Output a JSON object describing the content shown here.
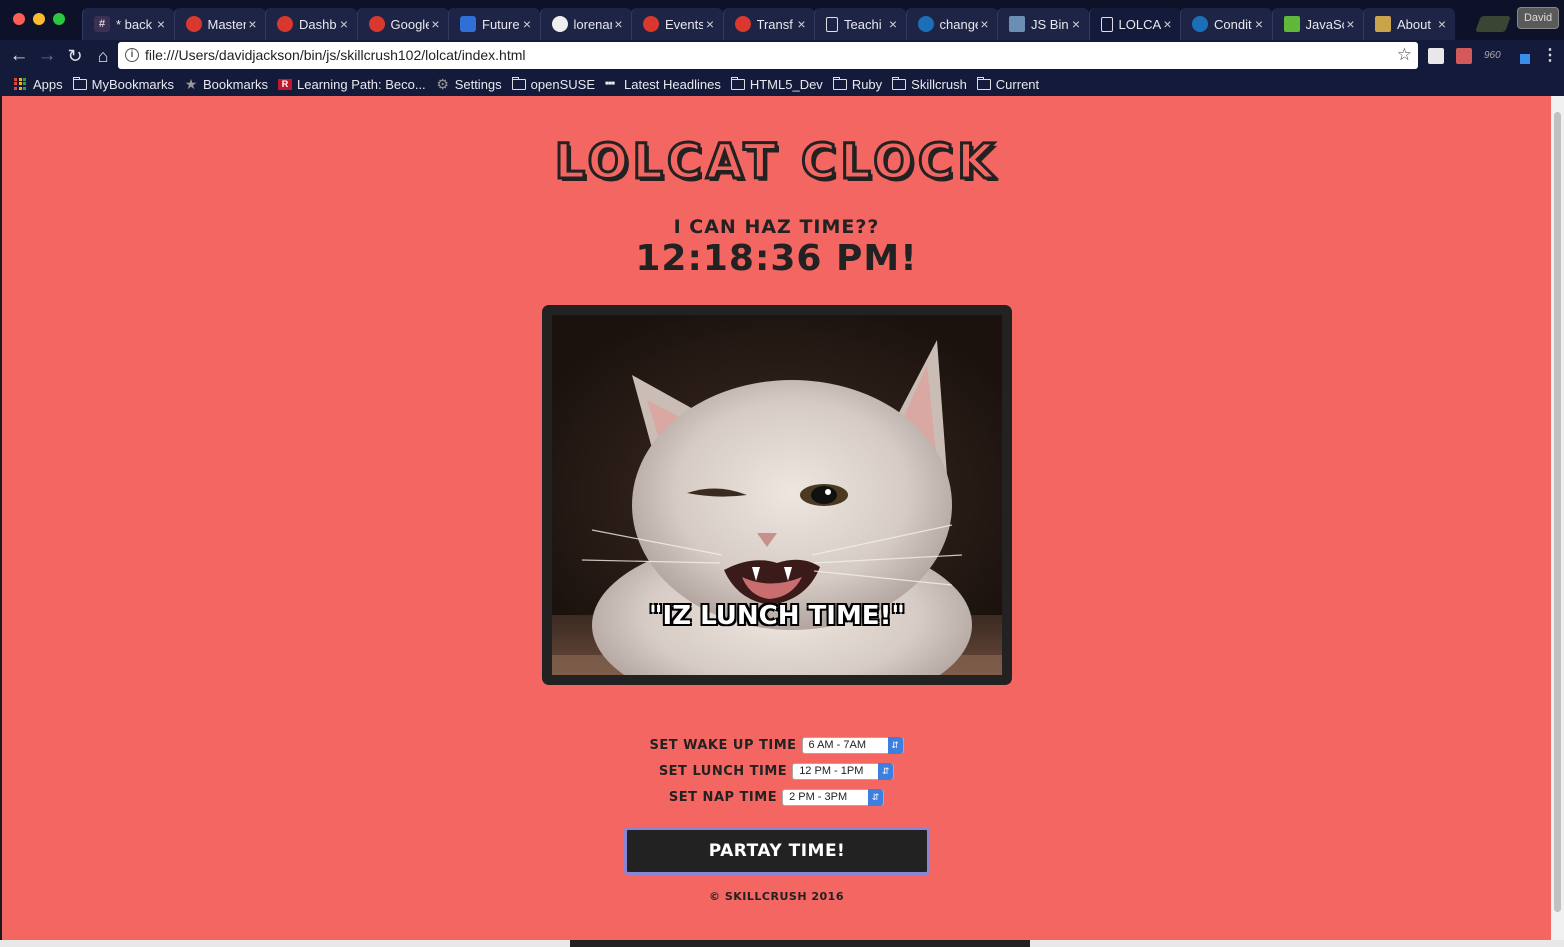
{
  "browser": {
    "tabs": [
      {
        "title": "* back",
        "icon": "slack-icon"
      },
      {
        "title": "Master",
        "icon": "red-app-icon"
      },
      {
        "title": "Dashb",
        "icon": "red-app-icon"
      },
      {
        "title": "Google",
        "icon": "red-app-icon"
      },
      {
        "title": "Future",
        "icon": "slides-icon"
      },
      {
        "title": "lorenar",
        "icon": "github-icon"
      },
      {
        "title": "Events",
        "icon": "red-app-icon"
      },
      {
        "title": "Transf",
        "icon": "red-app-icon"
      },
      {
        "title": "Teachi",
        "icon": "document-icon"
      },
      {
        "title": "change",
        "icon": "confluence-icon"
      },
      {
        "title": "JS Bin",
        "icon": "jsbin-icon"
      },
      {
        "title": "LOLCA",
        "icon": "document-icon"
      },
      {
        "title": "Condit",
        "icon": "confluence-icon"
      },
      {
        "title": "JavaSc",
        "icon": "green-app-icon"
      },
      {
        "title": "About",
        "icon": "python-icon"
      }
    ],
    "active_tab_index": 11,
    "profile_name": "David",
    "url": "file:///Users/davidjackson/bin/js/skillcrush102/lolcat/index.html",
    "bookmarks": [
      {
        "label": "Apps",
        "icon": "apps-grid-icon"
      },
      {
        "label": "MyBookmarks",
        "icon": "folder-icon"
      },
      {
        "label": "Bookmarks",
        "icon": "star-icon"
      },
      {
        "label": "Learning Path: Beco...",
        "icon": "r-logo-icon"
      },
      {
        "label": "Settings",
        "icon": "gear-icon"
      },
      {
        "label": "openSUSE",
        "icon": "folder-icon"
      },
      {
        "label": "Latest Headlines",
        "icon": "bbc-icon"
      },
      {
        "label": "HTML5_Dev",
        "icon": "folder-icon"
      },
      {
        "label": "Ruby",
        "icon": "folder-icon"
      },
      {
        "label": "Skillcrush",
        "icon": "folder-icon"
      },
      {
        "label": "Current",
        "icon": "folder-icon"
      }
    ]
  },
  "page": {
    "title": "LOLCAT CLOCK",
    "subtitle": "I CAN HAZ TIME??",
    "clock_time": "12:18:36 PM!",
    "image_caption": "\"IZ LUNCH TIME!\"",
    "settings": [
      {
        "label": "SET WAKE UP TIME",
        "selected": "6 AM - 7AM"
      },
      {
        "label": "SET LUNCH TIME",
        "selected": "12 PM - 1PM"
      },
      {
        "label": "SET NAP TIME",
        "selected": "2 PM - 3PM"
      }
    ],
    "party_button": "PARTAY TIME!",
    "footer": "© SKILLCRUSH 2016",
    "colors": {
      "background": "#f46661",
      "ink": "#222222",
      "button_border": "#8a84d6",
      "select_arrow": "#3d7fe0"
    }
  }
}
